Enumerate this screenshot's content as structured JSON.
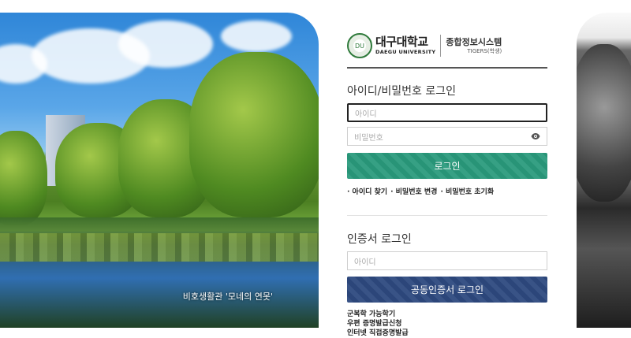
{
  "photo_left": {
    "caption": "비호생활관 '모네의 연못'"
  },
  "header": {
    "emblem_text": "DU",
    "univ_name": "대구대학교",
    "univ_name_en": "DAEGU UNIVERSITY",
    "system_name": "종합정보시스템",
    "system_sub": "TIGERS(학생)"
  },
  "id_login": {
    "title": "아이디/비밀번호 로그인",
    "id_placeholder": "아이디",
    "pw_placeholder": "비밀번호",
    "login_button": "로그인",
    "links": [
      "· 아이디 찾기",
      "· 비밀번호 변경",
      "· 비밀번호 초기화"
    ]
  },
  "cert_login": {
    "title": "인증서 로그인",
    "id_placeholder": "아이디",
    "button": "공동인증서 로그인"
  },
  "bottom_links": [
    "군복학 가능학기",
    "우편 증명발급신청",
    "인터넷 직접증명발급"
  ],
  "colors": {
    "login_green": "#2a9a7c",
    "cert_navy": "#2e4a80"
  }
}
